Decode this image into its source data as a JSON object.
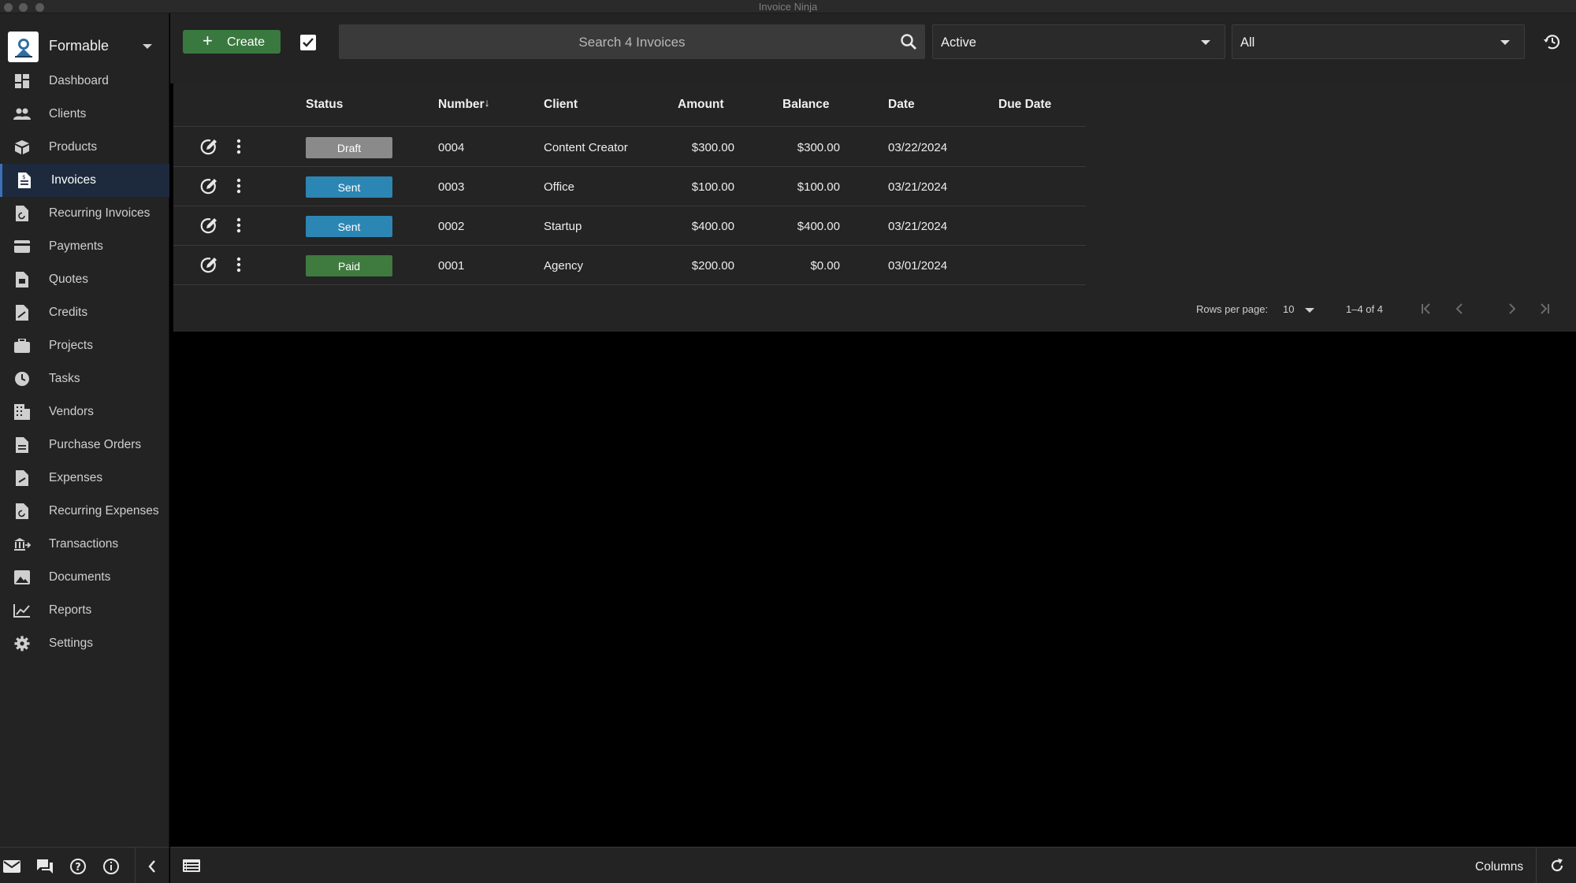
{
  "window": {
    "title": "Invoice Ninja"
  },
  "company": {
    "name": "Formable"
  },
  "nav": [
    {
      "label": "Dashboard",
      "icon": "dashboard-icon"
    },
    {
      "label": "Clients",
      "icon": "clients-icon"
    },
    {
      "label": "Products",
      "icon": "products-icon"
    },
    {
      "label": "Invoices",
      "icon": "invoices-icon",
      "active": true
    },
    {
      "label": "Recurring Invoices",
      "icon": "recurring-invoices-icon"
    },
    {
      "label": "Payments",
      "icon": "payments-icon"
    },
    {
      "label": "Quotes",
      "icon": "quotes-icon"
    },
    {
      "label": "Credits",
      "icon": "credits-icon"
    },
    {
      "label": "Projects",
      "icon": "projects-icon"
    },
    {
      "label": "Tasks",
      "icon": "tasks-icon"
    },
    {
      "label": "Vendors",
      "icon": "vendors-icon"
    },
    {
      "label": "Purchase Orders",
      "icon": "purchase-orders-icon"
    },
    {
      "label": "Expenses",
      "icon": "expenses-icon"
    },
    {
      "label": "Recurring Expenses",
      "icon": "recurring-expenses-icon"
    },
    {
      "label": "Transactions",
      "icon": "transactions-icon"
    },
    {
      "label": "Documents",
      "icon": "documents-icon"
    },
    {
      "label": "Reports",
      "icon": "reports-icon"
    },
    {
      "label": "Settings",
      "icon": "settings-icon"
    }
  ],
  "toolbar": {
    "create_label": "Create",
    "search_placeholder": "Search 4 Invoices",
    "status_filter": "Active",
    "group_filter": "All"
  },
  "table": {
    "columns": [
      "Status",
      "Number",
      "Client",
      "Amount",
      "Balance",
      "Date",
      "Due Date"
    ],
    "sort_indicator": "↓",
    "rows": [
      {
        "status": "Draft",
        "number": "0004",
        "client": "Content Creator",
        "amount": "$300.00",
        "balance": "$300.00",
        "date": "03/22/2024",
        "due_date": ""
      },
      {
        "status": "Sent",
        "number": "0003",
        "client": "Office",
        "amount": "$100.00",
        "balance": "$100.00",
        "date": "03/21/2024",
        "due_date": ""
      },
      {
        "status": "Sent",
        "number": "0002",
        "client": "Startup",
        "amount": "$400.00",
        "balance": "$400.00",
        "date": "03/21/2024",
        "due_date": ""
      },
      {
        "status": "Paid",
        "number": "0001",
        "client": "Agency",
        "amount": "$200.00",
        "balance": "$0.00",
        "date": "03/01/2024",
        "due_date": ""
      }
    ]
  },
  "status_colors": {
    "Draft": "#8a8a8a",
    "Sent": "#2c86b4",
    "Paid": "#3f7a3f"
  },
  "pagination": {
    "rows_per_page_label": "Rows per page:",
    "rows_per_page": "10",
    "range": "1–4 of 4"
  },
  "bottombar": {
    "columns_label": "Columns"
  }
}
